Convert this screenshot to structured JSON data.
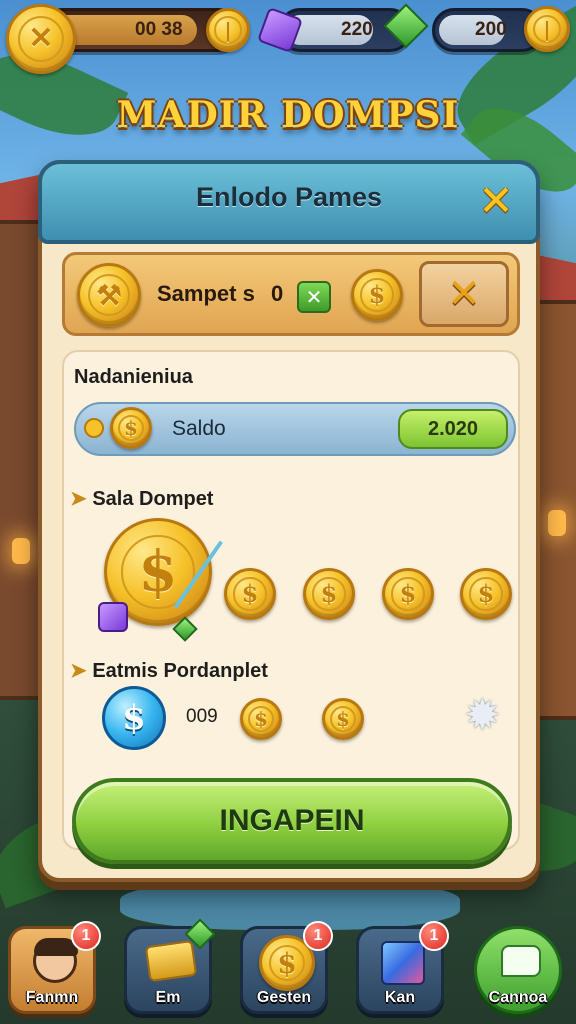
{
  "hud": {
    "gold_amount": "00 38",
    "gem_amount": "220",
    "coin_amount": "200"
  },
  "game_title": "MADIR DOMPSI",
  "panel": {
    "title": "Enlodo Pames",
    "row1": {
      "label": "Sampet s",
      "value": "0"
    },
    "section1": {
      "heading": "Nadanieniua",
      "saldo_label": "Saldo",
      "saldo_value": "2.020"
    },
    "section2": {
      "heading": "Sala Dompet"
    },
    "section3": {
      "heading": "Eatmis Pordanplet",
      "amount": "009"
    },
    "action_button": "INGAPEIN"
  },
  "bottom_nav": [
    {
      "label": "Fanmn",
      "badge": "1",
      "icon": "avatar-icon"
    },
    {
      "label": "Em",
      "badge": "",
      "icon": "gold-bars-icon"
    },
    {
      "label": "Gesten",
      "badge": "1",
      "icon": "coin-icon"
    },
    {
      "label": "Kan",
      "badge": "1",
      "icon": "cube-icon"
    },
    {
      "label": "Cannoa",
      "badge": "",
      "icon": "chat-icon"
    }
  ],
  "colors": {
    "accent_gold": "#f6c22a",
    "panel_bg": "#f6e8c8",
    "header_blue": "#3f8fb0",
    "action_green": "#8fd040"
  }
}
